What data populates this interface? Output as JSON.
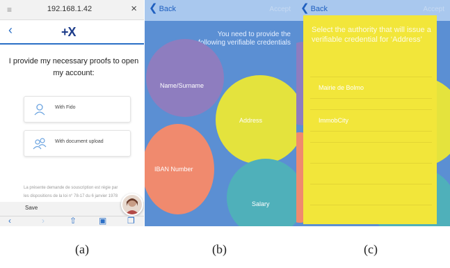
{
  "screen_a": {
    "url": "192.168.1.42",
    "logo": "+X",
    "heading": "I provide my necessary proofs to open my account:",
    "options": [
      {
        "label": "With Fido",
        "icon": "user-icon"
      },
      {
        "label": "With document upload",
        "icon": "users-icon"
      }
    ],
    "legal_line1": "La présente demande de souscription est régie par",
    "legal_line2": "les dispositions de la loi n° 78-17 du 6 janvier 1978",
    "save_label": "Save",
    "accent_color": "#2b6fc6",
    "logo_color": "#1d3c8a"
  },
  "screen_b": {
    "back_label": "Back",
    "accept_label": "Accept",
    "prompt": "You need to provide the following verifiable credentials",
    "bubbles": [
      {
        "label": "Name/Surname",
        "color": "#8e7dbf"
      },
      {
        "label": "Address",
        "color": "#e4e33d"
      },
      {
        "label": "IBAN Number",
        "color": "#f08a6e"
      },
      {
        "label": "Salary",
        "color": "#4fb0ba"
      }
    ],
    "background_color": "#5b8fd3"
  },
  "screen_c": {
    "back_label": "Back",
    "accept_label": "Accept",
    "panel_title": "Select the authority that will issue a verifiable credential for ‘Address’",
    "authorities": [
      "Mairie de Bolmo",
      "ImmobCity"
    ],
    "panel_color": "#f2e63a"
  },
  "captions": [
    "(a)",
    "(b)",
    "(c)"
  ]
}
